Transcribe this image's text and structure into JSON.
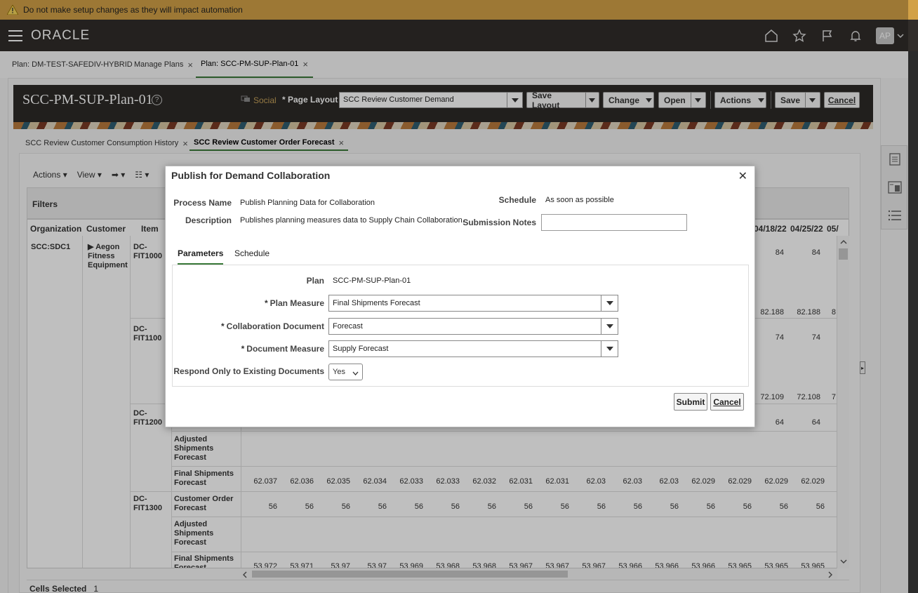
{
  "banner": {
    "text": "Do not make setup changes as they will impact automation"
  },
  "header": {
    "logo": "ORACLE",
    "avatar_initials": "AP"
  },
  "plan_tabs": [
    {
      "label": "Plan: DM-TEST-SAFEDIV-HYBRID"
    },
    {
      "label": "Manage Plans"
    },
    {
      "label": "Plan: SCC-PM-SUP-Plan-01"
    }
  ],
  "plan_header": {
    "title": "SCC-PM-SUP-Plan-01",
    "social": "Social",
    "page_layout_label": "* Page Layout",
    "page_layout_value": "SCC Review Customer Demand",
    "save_layout": "Save Layout",
    "change": "Change",
    "open": "Open",
    "actions": "Actions",
    "save": "Save",
    "cancel": "Cancel"
  },
  "inner_tabs": [
    {
      "label": "SCC Review Customer Consumption History"
    },
    {
      "label": "SCC Review Customer Order Forecast"
    }
  ],
  "toolbar": {
    "actions": "Actions",
    "view": "View"
  },
  "filters_label": "Filters",
  "grid": {
    "headers": {
      "organization": "Organization",
      "customer": "Customer",
      "item": "Item"
    },
    "date_headers": [
      "04/18/22",
      "04/25/22",
      "05/"
    ],
    "organization": "SCC:SDC1",
    "customer": "Aegon Fitness Equipment",
    "items": [
      "DC-FIT1000",
      "DC-FIT1100",
      "DC-FIT1200",
      "DC-FIT1300"
    ],
    "partial_values": {
      "r1": [
        "84",
        "84"
      ],
      "r2": [
        "82.188",
        "82.188",
        "8"
      ],
      "r3": [
        "74",
        "74"
      ],
      "r4": [
        "72.109",
        "72.108",
        "7"
      ],
      "r5": [
        "64",
        "64"
      ]
    },
    "measures": {
      "adjusted": "Adjusted Shipments Forecast",
      "final": "Final Shipments Forecast",
      "customer_order": "Customer Order Forecast"
    },
    "row_final_1200": [
      "62.037",
      "62.036",
      "62.035",
      "62.034",
      "62.033",
      "62.033",
      "62.032",
      "62.031",
      "62.031",
      "62.03",
      "62.03",
      "62.03",
      "62.029",
      "62.029",
      "62.029",
      "62.029",
      "6"
    ],
    "row_order_1300": [
      "56",
      "56",
      "56",
      "56",
      "56",
      "56",
      "56",
      "56",
      "56",
      "56",
      "56",
      "56",
      "56",
      "56",
      "56",
      "56"
    ],
    "row_final_1300": [
      "53.972",
      "53.971",
      "53.97",
      "53.97",
      "53.969",
      "53.968",
      "53.968",
      "53.967",
      "53.967",
      "53.967",
      "53.966",
      "53.966",
      "53.966",
      "53.965",
      "53.965",
      "53.965",
      "5"
    ]
  },
  "status": {
    "label": "Cells Selected",
    "value": "1"
  },
  "dialog": {
    "title": "Publish for Demand Collaboration",
    "process_name_label": "Process Name",
    "process_name": "Publish Planning Data for Collaboration",
    "description_label": "Description",
    "description": "Publishes planning measures data to Supply Chain Collaboration.",
    "schedule_label": "Schedule",
    "schedule_value": "As soon as possible",
    "submission_notes_label": "Submission Notes",
    "submission_notes_value": "",
    "tabs": [
      "Parameters",
      "Schedule"
    ],
    "plan_label": "Plan",
    "plan_value": "SCC-PM-SUP-Plan-01",
    "plan_measure_label": "Plan Measure",
    "plan_measure_value": "Final Shipments Forecast",
    "collab_doc_label": "Collaboration Document",
    "collab_doc_value": "Forecast",
    "doc_measure_label": "Document Measure",
    "doc_measure_value": "Supply Forecast",
    "respond_label": "Respond Only to Existing Documents",
    "respond_value": "Yes",
    "submit": "Submit",
    "cancel": "Cancel"
  }
}
